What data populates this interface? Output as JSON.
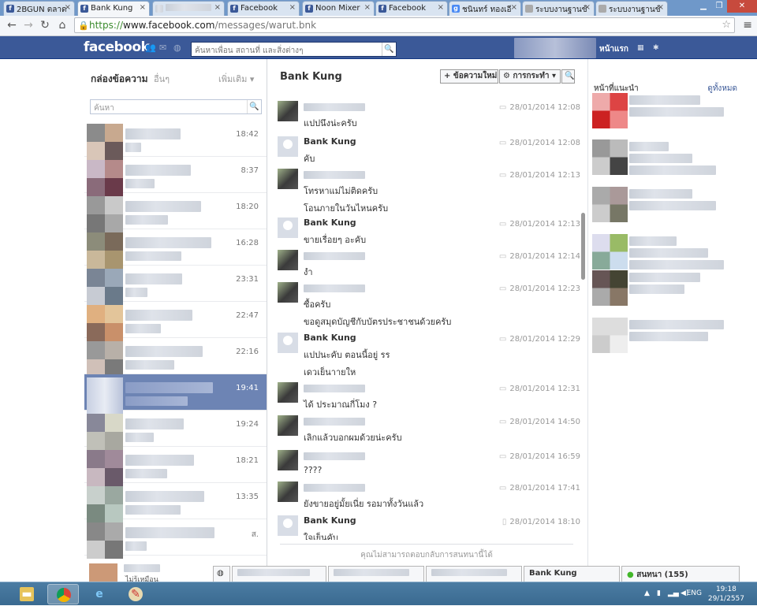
{
  "tabs": [
    {
      "label": "2BGUN ตลาด",
      "icon": "f",
      "color": "#3b5998"
    },
    {
      "label": "Bank Kung",
      "icon": "f",
      "color": "#3b5998"
    },
    {
      "label": "",
      "icon": "",
      "color": "#9aa"
    },
    {
      "label": "Facebook",
      "icon": "f",
      "color": "#3b5998"
    },
    {
      "label": "Noon Mixer",
      "icon": "f",
      "color": "#3b5998"
    },
    {
      "label": "Facebook",
      "icon": "f",
      "color": "#3b5998"
    },
    {
      "label": "ชนินทร์ ทองเอี",
      "icon": "g",
      "color": "#4a8af4"
    },
    {
      "label": "ระบบงานฐานข้",
      "icon": "d",
      "color": "#999"
    },
    {
      "label": "ระบบงานฐานข้",
      "icon": "d",
      "color": "#999"
    }
  ],
  "address": {
    "scheme": "https://",
    "host": "www.facebook.com",
    "path": "/messages/warut.bnk"
  },
  "fb": {
    "logo": "facebook",
    "search_placeholder": "ค้นหาเพื่อน สถานที่ และสิ่งต่างๆ",
    "home": "หน้าแรก"
  },
  "left": {
    "inbox": "กล่องข้อความ",
    "other": "อื่นๆ",
    "more": "เพิ่มเติม ▾",
    "search_placeholder": "ค้นหา",
    "times": [
      "18:42",
      "8:37",
      "18:20",
      "16:28",
      "23:31",
      "22:47",
      "22:16",
      "19:41",
      "19:24",
      "18:21",
      "13:35",
      "ส."
    ],
    "active_index": 7,
    "bottom_status": "ไม่รู้เหมือน"
  },
  "thread": {
    "name": "Bank Kung",
    "new_message": "+ ข้อความใหม่",
    "actions": "⚙ การกระทำ ▾",
    "search_icon": "search-icon",
    "reply_notice": "คุณไม่สามารถตอบกลับการสนทนานี้ได้"
  },
  "messages": [
    {
      "sender": "",
      "lines": [
        "แปปนึงน่ะครับ"
      ],
      "time": "28/01/2014 12:08"
    },
    {
      "sender": "Bank Kung",
      "lines": [
        "คับ"
      ],
      "time": "28/01/2014 12:08"
    },
    {
      "sender": "",
      "lines": [
        "โทรหาแม่ไม่ติดครับ",
        "โอนภายในวันไหนครับ"
      ],
      "time": "28/01/2014 12:13"
    },
    {
      "sender": "Bank Kung",
      "lines": [
        "ขายเรื่อยๆ อะคับ"
      ],
      "time": "28/01/2014 12:13"
    },
    {
      "sender": "",
      "lines": [
        "งำ"
      ],
      "time": "28/01/2014 12:14"
    },
    {
      "sender": "",
      "lines": [
        "ซื้อครับ",
        "ขอดูสมุดบัญชีกับบัตรประชาชนด้วยครับ"
      ],
      "time": "28/01/2014 12:23"
    },
    {
      "sender": "Bank Kung",
      "lines": [
        "แปปนะคับ ตอนนี้อยู่ รร",
        "เดวเย็นาายให"
      ],
      "time": "28/01/2014 12:29"
    },
    {
      "sender": "",
      "lines": [
        "ได้ ประมาณกี่โมง ?"
      ],
      "time": "28/01/2014 12:31"
    },
    {
      "sender": "",
      "lines": [
        "เลิกแล้วบอกผมด้วยน่ะครับ"
      ],
      "time": "28/01/2014 14:50"
    },
    {
      "sender": "",
      "lines": [
        "????"
      ],
      "time": "28/01/2014 16:59"
    },
    {
      "sender": "",
      "lines": [
        "ยังขายอยู่มั้ยเนี่ย รอมาทั้งวันแล้ว"
      ],
      "time": "28/01/2014 17:41"
    },
    {
      "sender": "Bank Kung",
      "lines": [
        "ใจเย็นคับ"
      ],
      "time": "28/01/2014 18:10"
    }
  ],
  "right": {
    "title": "หน้าที่แนะนำ",
    "see_all": "ดูทั้งหมด"
  },
  "chat": {
    "open_tab": "Bank Kung",
    "online": "สนทนา (155)"
  },
  "taskbar": {
    "lang": "ENG",
    "time": "19:18",
    "date": "29/1/2557"
  },
  "colors": {
    "fb_blue": "#3b5998",
    "active_row": "#6d84b4",
    "taskbar": "#3a6a90"
  }
}
